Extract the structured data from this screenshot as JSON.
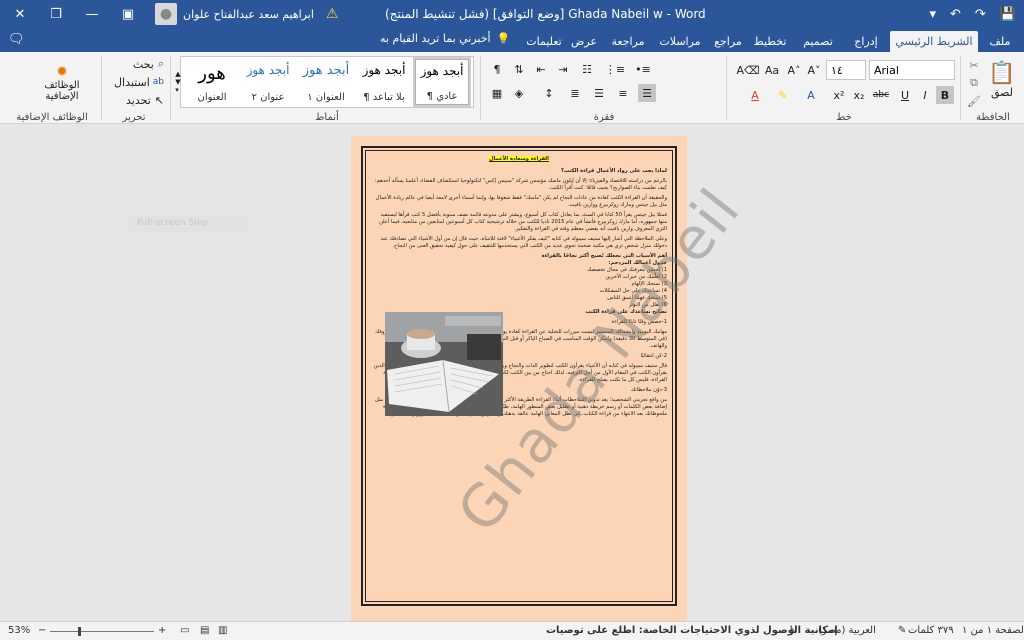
{
  "titlebar": {
    "document_title": "Ghada Nabeil w  -  Word  [وضع التوافق]  (فشل تنشيط المنتج)",
    "user_name": "ابراهيم سعد عبدالفتاح علوان"
  },
  "tabs": {
    "file": "ملف",
    "home": "الشريط الرئيسي",
    "insert": "إدراج",
    "design": "تصميم",
    "layout": "تخطيط",
    "references": "مراجع",
    "mailings": "مراسلات",
    "review": "مراجعة",
    "view": "عرض",
    "help": "تعليمات",
    "tell_me": "أخبرني بما تريد القيام به"
  },
  "ribbon": {
    "clipboard": {
      "paste": "لصق",
      "label": "الحافظة"
    },
    "font": {
      "name": "Arial",
      "size": "١٤",
      "label": "خط"
    },
    "paragraph": {
      "label": "فقرة"
    },
    "styles": {
      "label": "أنماط",
      "items": [
        {
          "sample": "أبجد هوز",
          "name": "¶ عادي"
        },
        {
          "sample": "أبجد هوز",
          "name": "¶ بلا تباعد"
        },
        {
          "sample": "أبجد هوز",
          "name": "العنوان ١"
        },
        {
          "sample": "أبجد هوز",
          "name": "عنوان ٢"
        },
        {
          "sample": "هور",
          "name": "العنوان"
        }
      ]
    },
    "editing": {
      "find": "بحث",
      "replace": "استبدال",
      "select": "تحديد",
      "label": "تحرير"
    },
    "addins": {
      "button": "الوظائف الإضافية",
      "label": "الوظائف الإضافية"
    }
  },
  "document": {
    "heading": "القراءة وسعادة الأعمال",
    "paragraphs": [
      "لماذا يجب على رواد الأعمال قراءة الكتب؟",
      "بالرغم من دراسته للاقتصاد والفيزياء؛ إلا أن إيلون ماسك مؤسس شركة \"سبيس إكس\" لتكنولوجيا استكشاف الفضاء، أعلمنا يسأله أحدهم: كيف تعلمت بناء الصواريخ؟ يجيب قائلا: كنت أقرأ الكتب.",
      "والحقيقة أن القراءة الكتب كعادة من عادات النجاح لم يكن \"ماسك\" فقط شغوفا بها، وإنما أسماء أخرى لامعة أيضا في عالم ريادة الأعمال مثل بيل جيتس ومارك زوكربيرغ ووارين بافيت.",
      "فمثلا بيل جيتس يقرأ 50 كتابا في السنة، بما يعادل كتاب كل أسبوع، ويشتر على مدونته قائمة نصف سنوية بأفضل 5 كتب قرأها ليستفيد منها جمهوره، أما مارك زوكربيرج فأنشأ في عام 2015 ناديا للكتب من خلاله ترشيحية كتاب كل أسبوعين لمتابعين من متابعيه، فيما أعلن الثري المعروف وارين بافيت أنه يقضي معظم وقته في القراءة والتفكير.",
      "وعلى الملاحظة التي أشار إليها ستيف سيبولد في كتابه \"كيف يفكر الأغنياء\" لافتة للانتباه، حيث قال إن من أول الأشياء التي تصادفك عند دخولك منزل شخص ثري هي مكتبة ضخمة تحوي عديد من الكتب التي يستخدمها للتثقيف على حول كيفية تحقيق الغنى من النجاح.",
      "أهم الأسباب التي تجعلك تُصبح أكثر نجاحًا بالقراءة",
      "جدول أعمالك المزدحم:",
      "1) تُحسّن معرفتك في مجال تخصصك",
      "2) تُعلّمك من خبرات الآخرين",
      "3) تمنحك الإلهام",
      "4) تساعدك على حل المشكلات",
      "5) تمنحك فهمًا أعمق للناس",
      "6) تقلل من التوتر",
      "نصائح تساعدك على قراءة الكتب",
      "1-خصص وقتًا ثابتًا للقراءة",
      "مهامك اليومية وانشغالك المستمر ليست مبررات للتخلية عن القراءة كعادة يومية، لذلك خصص وقتًا ثابتًا في يومك للقراءة بحسب ظروفك (في المتوسط 30 دقيقة) ويُمكن الوقت المناسب في الصباح الباكر أو قبل النوم، عن اختيار مكان هادئ بعيدًا عن المشتتات كالتلفاز والهاتف.",
      "2-كن انتقائيًا",
      "قال ستيف سيبولد في كتابه أن الأغنياء يقرأون الكتب لتطوير الذات والنجاح ويطورونها بوابة للتعلم والمعرفة، على عكس عامة الناس الذين يقرأون الكتب في المقام الأول من أجل الترفيه، لذلك احتاج من بين الكتب لكي يكتشف كتبًا ويكتب كتبًا مفيدة. لذلك احرص على ثقافة القراءة، فليس كل ما تكتب يصلح للقراءة.",
      "3-دوّن ملاحظاتك",
      "من واقع تجربتي الشخصية؛ يعد تدوين الملاحظات أثناء القراءة الطريقة الأكثر فعالية للاستفادة من محتوى الكتاب، ويأخذ أشكالا عديدة مثل إضافة بعض الكلمات أو رسم خريطة ذهنية أو تظليل بعض السطور الهامة، طبّق هذه النصيحة في الكتب الهامة بالنسبة لك، ولعد قراءة ملحوظاتك بعد الانتهاء من قراءة الكتاب، كي تظل المعاني الهامة عالقة بذهنك وتتذكر مع باقي محتوى الكتاب بعد مرور وقت قصير."
    ],
    "watermark": "Ghada Nabeil",
    "snip_hint": "Full-screen Snip"
  },
  "statusbar": {
    "page": "الصفحة ١ من ١",
    "words": "٣٧٩ كلمات",
    "language": "العربية (مصر)",
    "accessibility": "إمكانية الوصول لذوي الاحتياجات الخاصة: اطلع على توصيات",
    "zoom": "53%"
  },
  "colors": {
    "title_bar": "#2b579a",
    "page_fill": "#fbd5b5",
    "highlight": "#ffff00"
  }
}
